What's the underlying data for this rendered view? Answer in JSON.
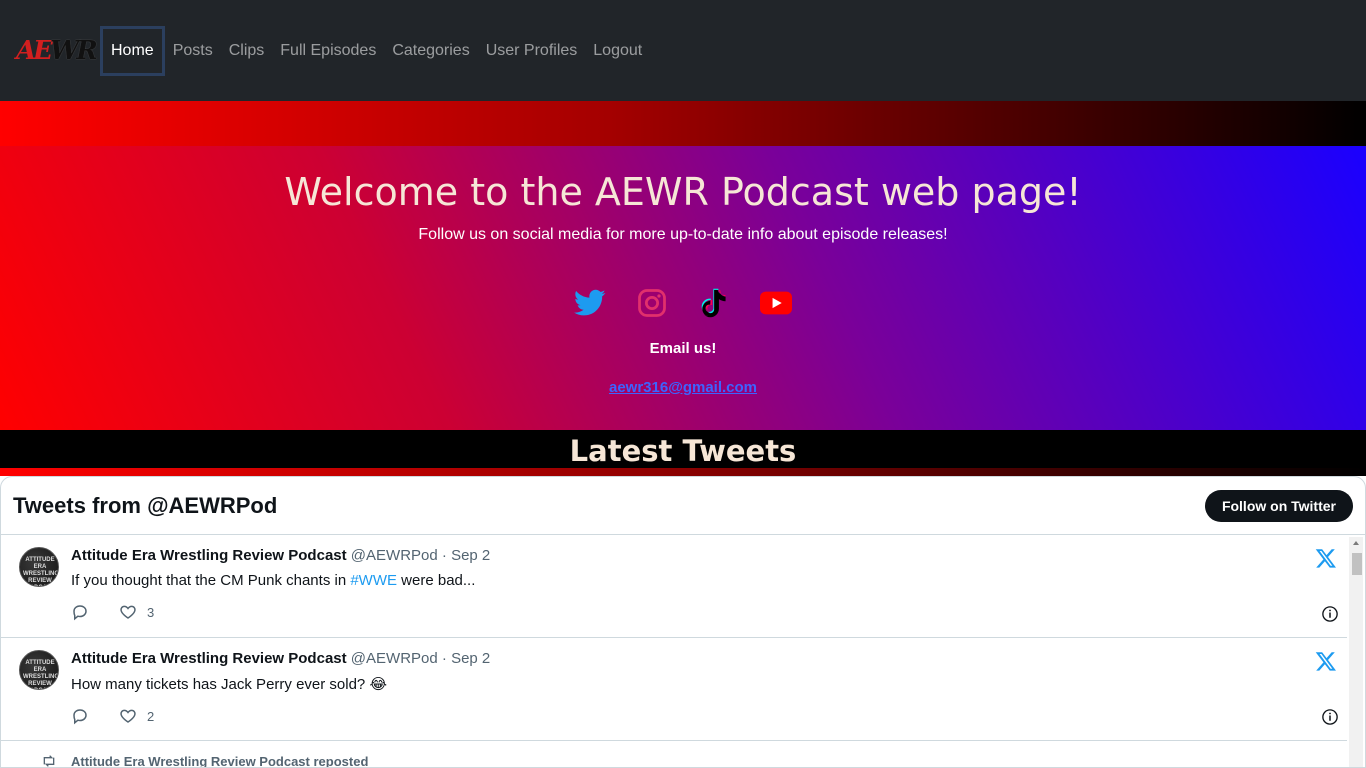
{
  "nav": {
    "brand": {
      "ae": "AE",
      "wr": "WR"
    },
    "items": [
      {
        "label": "Home",
        "active": true
      },
      {
        "label": "Posts"
      },
      {
        "label": "Clips"
      },
      {
        "label": "Full Episodes"
      },
      {
        "label": "Categories"
      },
      {
        "label": "User Profiles"
      },
      {
        "label": "Logout"
      }
    ]
  },
  "hero": {
    "title": "Welcome to the AEWR Podcast web page!",
    "subtitle": "Follow us on social media for more up-to-date info about episode releases!",
    "socials": [
      {
        "name": "twitter-icon",
        "color": "#1d9bf0"
      },
      {
        "name": "instagram-icon",
        "color": "#e1306c"
      },
      {
        "name": "tiktok-icon",
        "color": "#000000"
      },
      {
        "name": "youtube-icon",
        "color": "#ff0000"
      }
    ],
    "email_label": "Email us!",
    "email": "aewr316@gmail.com"
  },
  "latest": {
    "title": "Latest Tweets"
  },
  "timeline": {
    "title": "Tweets from @AEWRPod",
    "follow_label": "Follow on Twitter",
    "avatar_text": "ATTITUDE ERA WRESTLING REVIEW PODCAST",
    "tweets": [
      {
        "name": "Attitude Era Wrestling Review Podcast",
        "handle": "@AEWRPod",
        "dot": "·",
        "date": "Sep 2",
        "text_before": "If you thought that the CM Punk chants in ",
        "hashtag": "#WWE",
        "text_after": " were bad...",
        "likes": "3"
      },
      {
        "name": "Attitude Era Wrestling Review Podcast",
        "handle": "@AEWRPod",
        "dot": "·",
        "date": "Sep 2",
        "text_before": "How many tickets has Jack Perry ever sold? 😂",
        "hashtag": "",
        "text_after": "",
        "likes": "2"
      }
    ],
    "repost_label": "Attitude Era Wrestling Review Podcast reposted"
  }
}
